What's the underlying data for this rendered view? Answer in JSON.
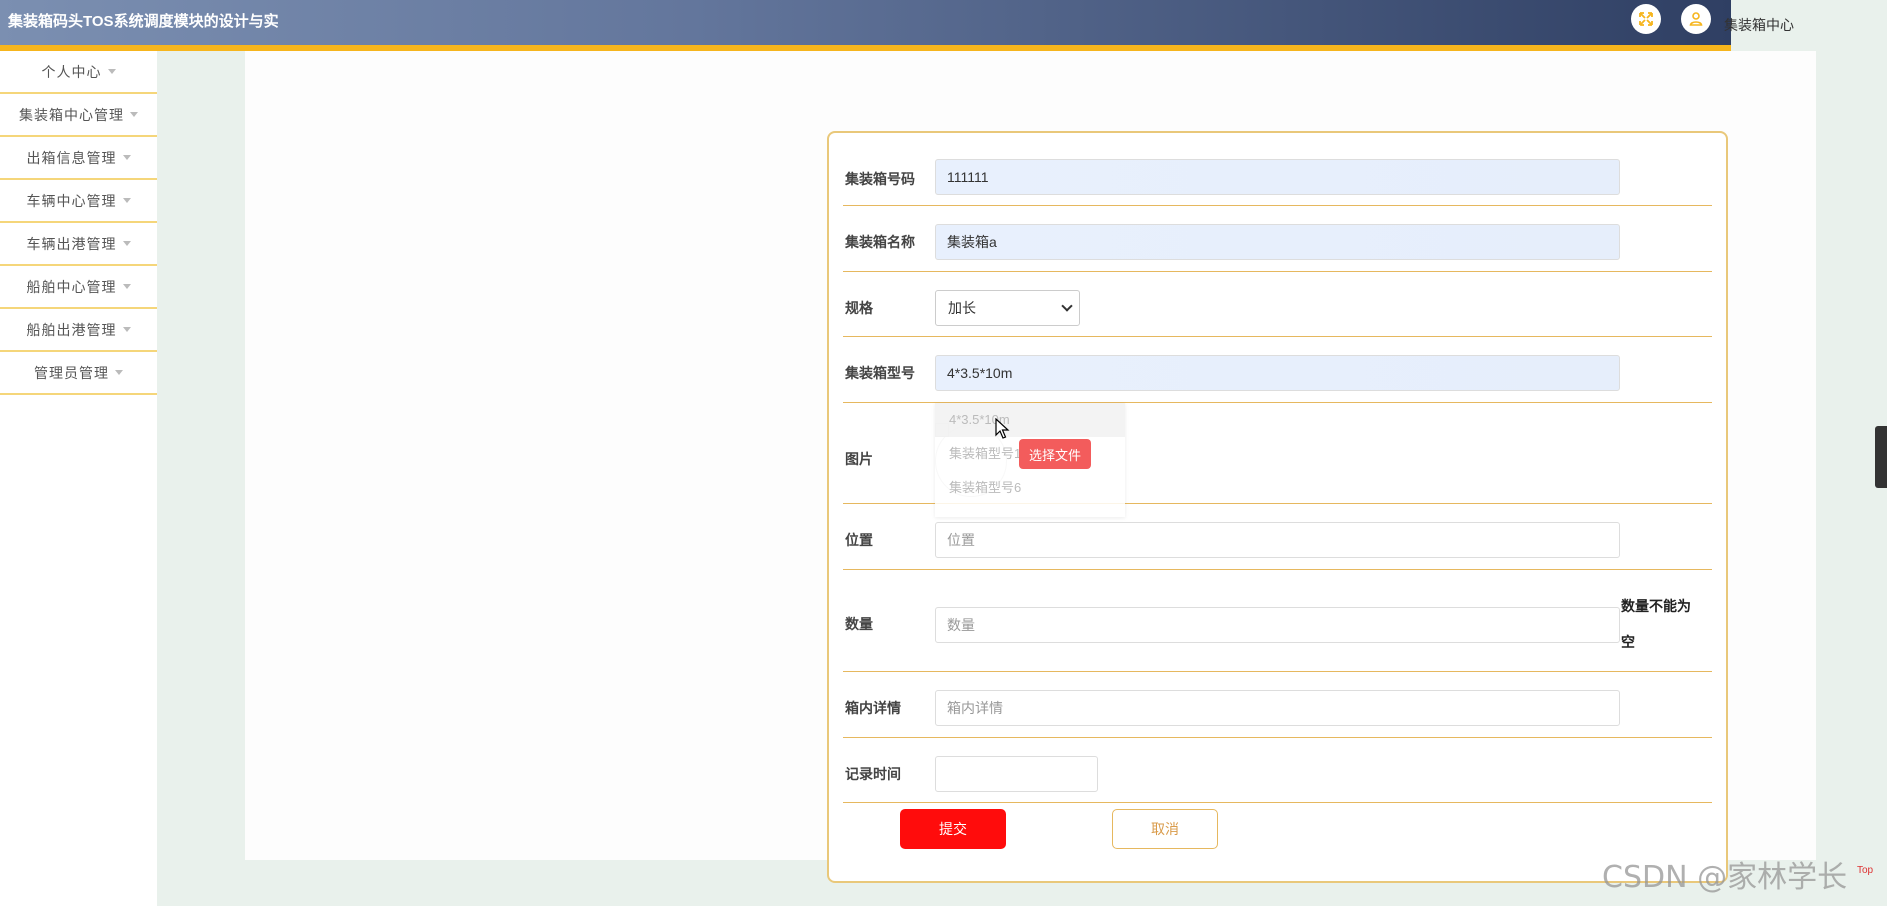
{
  "header": {
    "title": "集装箱码头TOS系统调度模块的设计与实",
    "user_label": "集装箱中心",
    "fullscreen_icon": "expand-icon",
    "user_icon": "user-icon"
  },
  "sidebar": {
    "items": [
      {
        "label": "个人中心"
      },
      {
        "label": "集装箱中心管理"
      },
      {
        "label": "出箱信息管理"
      },
      {
        "label": "车辆中心管理"
      },
      {
        "label": "车辆出港管理"
      },
      {
        "label": "船舶中心管理"
      },
      {
        "label": "船舶出港管理"
      },
      {
        "label": "管理员管理"
      }
    ]
  },
  "form": {
    "container_code": {
      "label": "集装箱号码",
      "value": "111111"
    },
    "container_name": {
      "label": "集装箱名称",
      "value": "集装箱a"
    },
    "spec": {
      "label": "规格",
      "value": "加长"
    },
    "model": {
      "label": "集装箱型号",
      "value": "4*3.5*10m"
    },
    "image": {
      "label": "图片",
      "upload_button": "选择文件",
      "autocomplete": [
        "4*3.5*10m",
        "集装箱型号1",
        "集装箱型号6"
      ]
    },
    "location": {
      "label": "位置",
      "placeholder": "位置",
      "value": ""
    },
    "quantity": {
      "label": "数量",
      "placeholder": "数量",
      "value": "",
      "error_line1": "数量不能为",
      "error_line2": "空"
    },
    "details": {
      "label": "箱内详情",
      "placeholder": "箱内详情",
      "value": ""
    },
    "record_time": {
      "label": "记录时间",
      "value": ""
    },
    "submit": "提交",
    "cancel": "取消"
  },
  "watermark": "CSDN @家林学长",
  "top_button": "Top",
  "colors": {
    "accent": "#f6b51d",
    "submit": "#ff0c0c",
    "upload": "#f35c5c",
    "border": "#e6b85f"
  }
}
